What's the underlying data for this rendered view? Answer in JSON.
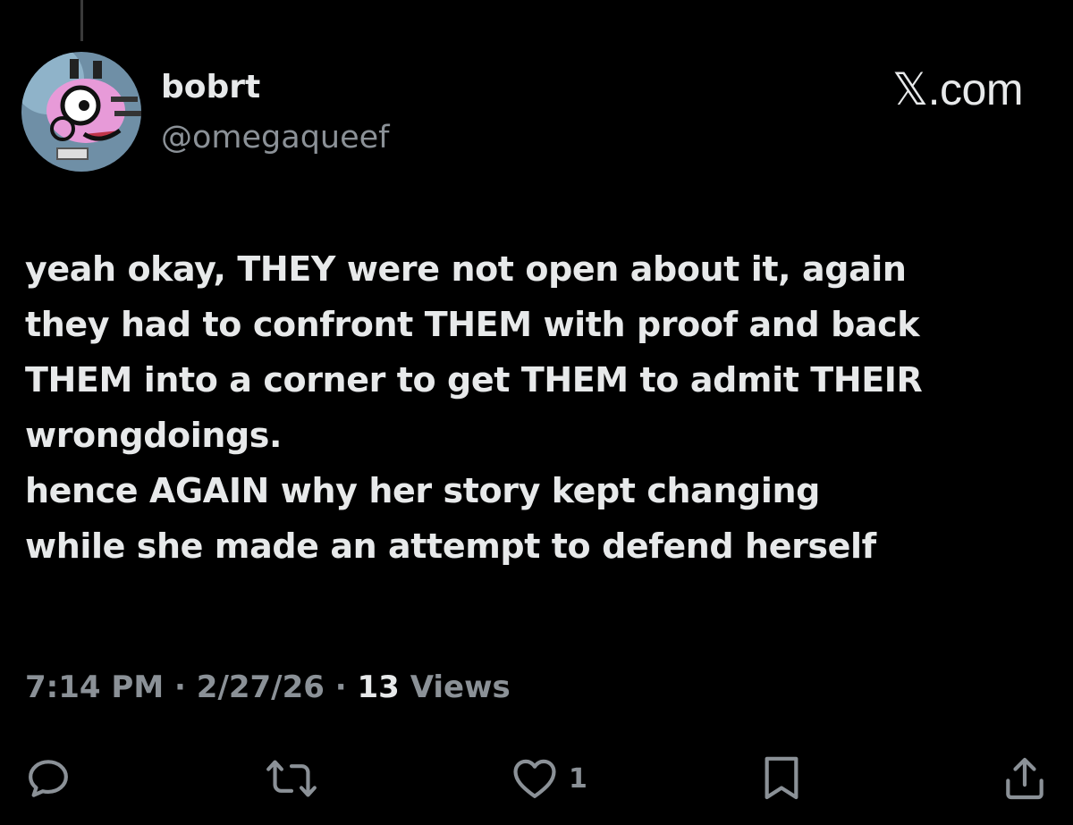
{
  "author": {
    "display_name": "bobrt",
    "handle": "@omegaqueef"
  },
  "brand": "𝕏.com",
  "tweet": {
    "text": "yeah okay, THEY were not open about it, again\nthey had to confront THEM with proof and back\nTHEM into a corner to get THEM to admit THEIR\nwrongdoings.\nhence AGAIN why her story kept changing\nwhile she made an attempt to defend herself"
  },
  "meta": {
    "time": "7:14 PM",
    "date": "2/27/26",
    "views_count": "13",
    "views_label": "Views",
    "separator": "·"
  },
  "actions": {
    "likes_count": "1"
  },
  "icons": {
    "reply": "reply-icon",
    "repost": "repost-icon",
    "like": "heart-icon",
    "bookmark": "bookmark-icon",
    "share": "share-icon"
  },
  "colors": {
    "background": "#000000",
    "text_primary": "#e7e9ea",
    "text_secondary": "#8b9197"
  }
}
